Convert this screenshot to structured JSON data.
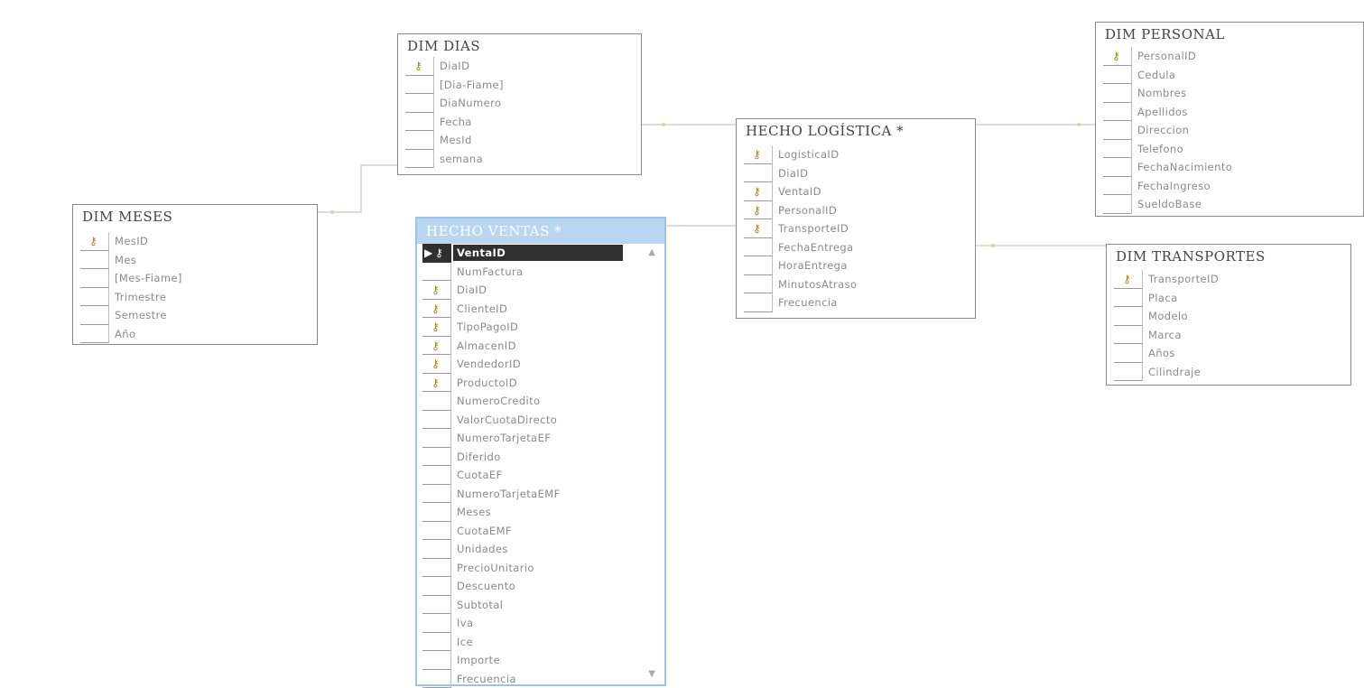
{
  "tables": {
    "dim_dias": {
      "title": "DIM DIAS",
      "fields": [
        {
          "name": "DiaID",
          "key": true
        },
        {
          "name": "[Dia-Fiame]",
          "key": false
        },
        {
          "name": "DiaNumero",
          "key": false
        },
        {
          "name": "Fecha",
          "key": false
        },
        {
          "name": "MesId",
          "key": false
        },
        {
          "name": "semana",
          "key": false
        }
      ]
    },
    "dim_meses": {
      "title": "DIM MESES",
      "fields": [
        {
          "name": "MesID",
          "key": true
        },
        {
          "name": "Mes",
          "key": false
        },
        {
          "name": "[Mes-Fiame]",
          "key": false
        },
        {
          "name": "Trimestre",
          "key": false
        },
        {
          "name": "Semestre",
          "key": false
        },
        {
          "name": "Año",
          "key": false
        }
      ]
    },
    "hecho_ventas": {
      "title": "HECHO VENTAS *",
      "fields": [
        {
          "name": "VentaID",
          "key": true
        },
        {
          "name": "NumFactura",
          "key": false
        },
        {
          "name": "DiaID",
          "key": true
        },
        {
          "name": "ClienteID",
          "key": true
        },
        {
          "name": "TipoPagoID",
          "key": true
        },
        {
          "name": "AlmacenID",
          "key": true
        },
        {
          "name": "VendedorID",
          "key": true
        },
        {
          "name": "ProductoID",
          "key": true
        },
        {
          "name": "NumeroCredito",
          "key": false
        },
        {
          "name": "ValorCuotaDirecto",
          "key": false
        },
        {
          "name": "NumeroTarjetaEF",
          "key": false
        },
        {
          "name": "Diferido",
          "key": false
        },
        {
          "name": "CuotaEF",
          "key": false
        },
        {
          "name": "NumeroTarjetaEMF",
          "key": false
        },
        {
          "name": "Meses",
          "key": false
        },
        {
          "name": "CuotaEMF",
          "key": false
        },
        {
          "name": "Unidades",
          "key": false
        },
        {
          "name": "PrecioUnitario",
          "key": false
        },
        {
          "name": "Descuento",
          "key": false
        },
        {
          "name": "Subtotal",
          "key": false
        },
        {
          "name": "Iva",
          "key": false
        },
        {
          "name": "Ice",
          "key": false
        },
        {
          "name": "Importe",
          "key": false
        },
        {
          "name": "Frecuencia",
          "key": false
        }
      ]
    },
    "hecho_logistica": {
      "title": "HECHO LOGÍSTICA *",
      "fields": [
        {
          "name": "LogisticaID",
          "key": true
        },
        {
          "name": "DiaID",
          "key": false
        },
        {
          "name": "VentaID",
          "key": true
        },
        {
          "name": "PersonalID",
          "key": true
        },
        {
          "name": "TransporteID",
          "key": true
        },
        {
          "name": "FechaEntrega",
          "key": false
        },
        {
          "name": "HoraEntrega",
          "key": false
        },
        {
          "name": "MinutosAtraso",
          "key": false
        },
        {
          "name": "Frecuencia",
          "key": false
        }
      ]
    },
    "dim_personal": {
      "title": "DIM PERSONAL",
      "fields": [
        {
          "name": "PersonalID",
          "key": true
        },
        {
          "name": "Cedula",
          "key": false
        },
        {
          "name": "Nombres",
          "key": false
        },
        {
          "name": "Apellidos",
          "key": false
        },
        {
          "name": "Direccion",
          "key": false
        },
        {
          "name": "Telefono",
          "key": false
        },
        {
          "name": "FechaNacimiento",
          "key": false
        },
        {
          "name": "FechaIngreso",
          "key": false
        },
        {
          "name": "SueldoBase",
          "key": false
        }
      ]
    },
    "dim_transportes": {
      "title": "DIM TRANSPORTES",
      "fields": [
        {
          "name": "TransporteID",
          "key": true
        },
        {
          "name": "Placa",
          "key": false
        },
        {
          "name": "Modelo",
          "key": false
        },
        {
          "name": "Marca",
          "key": false
        },
        {
          "name": "Años",
          "key": false
        },
        {
          "name": "Cilindraje",
          "key": false
        }
      ]
    }
  },
  "icons": {
    "key": "key-icon",
    "row_selector": "row-selector-icon"
  },
  "colors": {
    "selected_header": "#b9d5ef",
    "key_icon": "#a08a1f",
    "highlight_row": "#303030"
  }
}
